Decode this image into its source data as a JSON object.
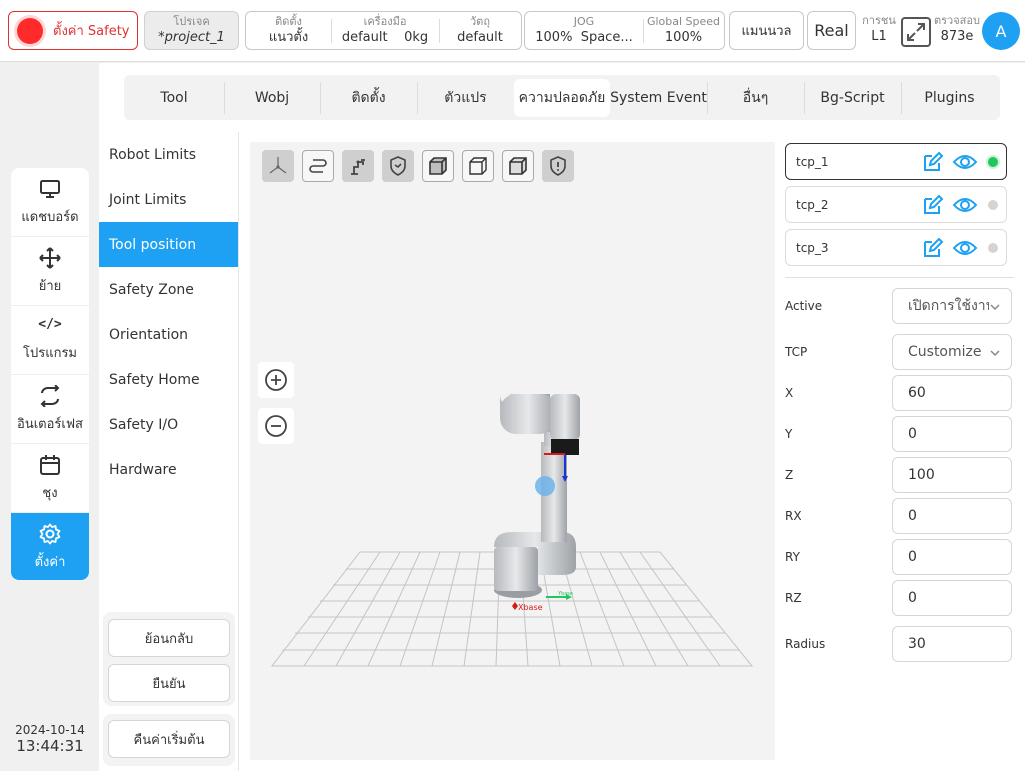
{
  "topbar": {
    "safety_label": "ตั้งค่า Safety",
    "project": {
      "label": "โปรเจค",
      "value": "*project_1"
    },
    "install": {
      "label": "ติดตั้ง",
      "value": "แนวตั้ง"
    },
    "tool": {
      "label": "เครื่องมือ",
      "value": "default",
      "weight": "0kg"
    },
    "material": {
      "label": "วัตถุ",
      "value": "default"
    },
    "jog": {
      "label": "JOG",
      "value": "100%",
      "mode": "Space..."
    },
    "global_speed": {
      "label": "Global Speed",
      "value": "100%"
    },
    "manual_label": "แมนนวล",
    "real_label": "Real",
    "collision": {
      "label": "การชน",
      "value": "L1"
    },
    "check": {
      "label": "ตรวจสอบ",
      "value": "873e"
    },
    "avatar": "A",
    "colors": {
      "accent": "#1ea1f2",
      "safety_red": "#e03131",
      "active_green": "#22c55e"
    }
  },
  "leftnav": {
    "items": [
      {
        "label": "แดชบอร์ด",
        "icon": "monitor-icon"
      },
      {
        "label": "ย้าย",
        "icon": "move-icon"
      },
      {
        "label": "โปรแกรม",
        "icon": "code-icon",
        "glyph": "</>"
      },
      {
        "label": "อินเตอร์เฟส",
        "icon": "swap-icon"
      },
      {
        "label": "ชุง",
        "icon": "calendar-icon"
      },
      {
        "label": "ตั้งค่า",
        "icon": "gear-icon"
      }
    ],
    "active": "ตั้งค่า"
  },
  "datetime": {
    "date": "2024-10-14",
    "time": "13:44:31"
  },
  "tabs": [
    "Tool",
    "Wobj",
    "ติดตั้ง",
    "ตัวแปร",
    "ความปลอดภัย",
    "System Event",
    "อื่นๆ",
    "Bg-Script",
    "Plugins"
  ],
  "active_tab": "ความปลอดภัย",
  "subnav": {
    "items": [
      "Robot Limits",
      "Joint Limits",
      "Tool position",
      "Safety Zone",
      "Orientation",
      "Safety Home",
      "Safety I/O",
      "Hardware"
    ],
    "active": "Tool position"
  },
  "buttons": {
    "back": "ย้อนกลับ",
    "confirm": "ยืนยัน",
    "reset": "คืนค่าเริ่มต้น"
  },
  "viewport": {
    "tools": [
      "axis-view-icon",
      "path-icon",
      "robot-arm-icon",
      "shield-check-icon",
      "cube-solid-icon",
      "cube-wire-icon",
      "cube-outline-icon",
      "shield-alert-icon"
    ],
    "base_label": "Xbase",
    "y_label": "Ybase"
  },
  "tcps": [
    {
      "name": "tcp_1",
      "active": true
    },
    {
      "name": "tcp_2",
      "active": false
    },
    {
      "name": "tcp_3",
      "active": false
    }
  ],
  "fields": [
    {
      "label": "Active",
      "value": "เปิดการใช้งาน",
      "type": "select"
    },
    {
      "label": "TCP",
      "value": "Customize",
      "type": "select"
    },
    {
      "label": "X",
      "value": "60"
    },
    {
      "label": "Y",
      "value": "0"
    },
    {
      "label": "Z",
      "value": "100"
    },
    {
      "label": "RX",
      "value": "0"
    },
    {
      "label": "RY",
      "value": "0"
    },
    {
      "label": "RZ",
      "value": "0"
    },
    {
      "label": "Radius",
      "value": "30"
    }
  ]
}
